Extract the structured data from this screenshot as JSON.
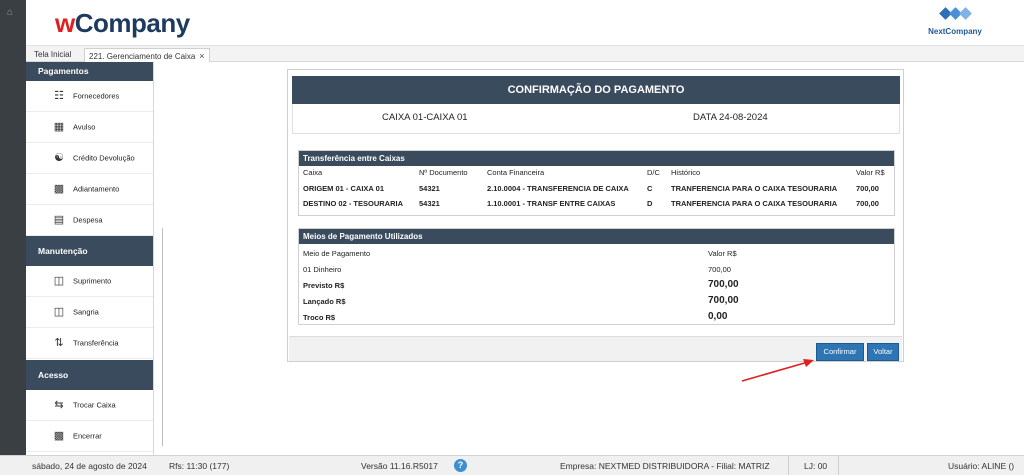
{
  "header": {
    "logo_w": "w",
    "logo_rest": "Company",
    "partner_logo": "NextCompany"
  },
  "tabs": [
    {
      "label": "Tela Inicial"
    },
    {
      "label": "221. Gerenciamento de Caixa",
      "close": "×"
    }
  ],
  "sidebar": {
    "sections": [
      {
        "label": "Pagamentos"
      },
      {
        "label": "Manutenção"
      },
      {
        "label": "Acesso"
      }
    ],
    "items": [
      {
        "label": "Fornecedores",
        "icon": "supplier-icon"
      },
      {
        "label": "Avulso",
        "icon": "document-grid-icon"
      },
      {
        "label": "Crédito Devolução",
        "icon": "money-hand-icon"
      },
      {
        "label": "Adiantamento",
        "icon": "advance-icon"
      },
      {
        "label": "Despesa",
        "icon": "expense-icon"
      },
      {
        "label": "Suprimento",
        "icon": "cash-register-icon"
      },
      {
        "label": "Sangria",
        "icon": "cash-register-icon"
      },
      {
        "label": "Transferência",
        "icon": "transfer-arrows-icon"
      },
      {
        "label": "Trocar Caixa",
        "icon": "swap-icon"
      },
      {
        "label": "Encerrar",
        "icon": "close-register-icon"
      }
    ]
  },
  "panel": {
    "title": "CONFIRMAÇÃO DO PAGAMENTO",
    "caixa": "CAIXA  01-CAIXA 01",
    "data": "DATA  24-08-2024",
    "transfer": {
      "title": "Transferência entre Caixas",
      "columns": [
        "Caixa",
        "Nº Documento",
        "Conta Financeira",
        "D/C",
        "Histórico",
        "Valor R$"
      ],
      "rows": [
        [
          "ORIGEM 01 - CAIXA 01",
          "54321",
          "2.10.0004 - TRANSFERENCIA DE CAIXA",
          "C",
          "TRANFERENCIA PARA O CAIXA TESOURARIA",
          "700,00"
        ],
        [
          "DESTINO 02 - TESOURARIA",
          "54321",
          "1.10.0001 - TRANSF ENTRE CAIXAS",
          "D",
          "TRANFERENCIA PARA O CAIXA TESOURARIA",
          "700,00"
        ]
      ]
    },
    "payment": {
      "title": "Meios de Pagamento Utilizados",
      "col_method": "Meio de Pagamento",
      "col_value": "Valor R$",
      "method": "01 Dinheiro",
      "method_value": "700,00",
      "previsto_label": "Previsto R$",
      "previsto_value": "700,00",
      "lancado_label": "Lançado R$",
      "lancado_value": "700,00",
      "troco_label": "Troco R$",
      "troco_value": "0,00"
    },
    "confirm_label": "Confirmar",
    "back_label": "Voltar"
  },
  "status": {
    "date": "sábado, 24 de agosto de 2024",
    "rfs": "Rfs: 11:30 (177)",
    "version": "Versão 11.16.R5017",
    "help": "?",
    "company": "Empresa: NEXTMED DISTRIBUIDORA - Filial: MATRIZ",
    "lj": "LJ: 00",
    "user": "Usuário: ALINE ()"
  },
  "colors": {
    "brand_dark": "#3a4b5e",
    "button_blue": "#2e75b6",
    "annotation_red": "#e02020"
  }
}
